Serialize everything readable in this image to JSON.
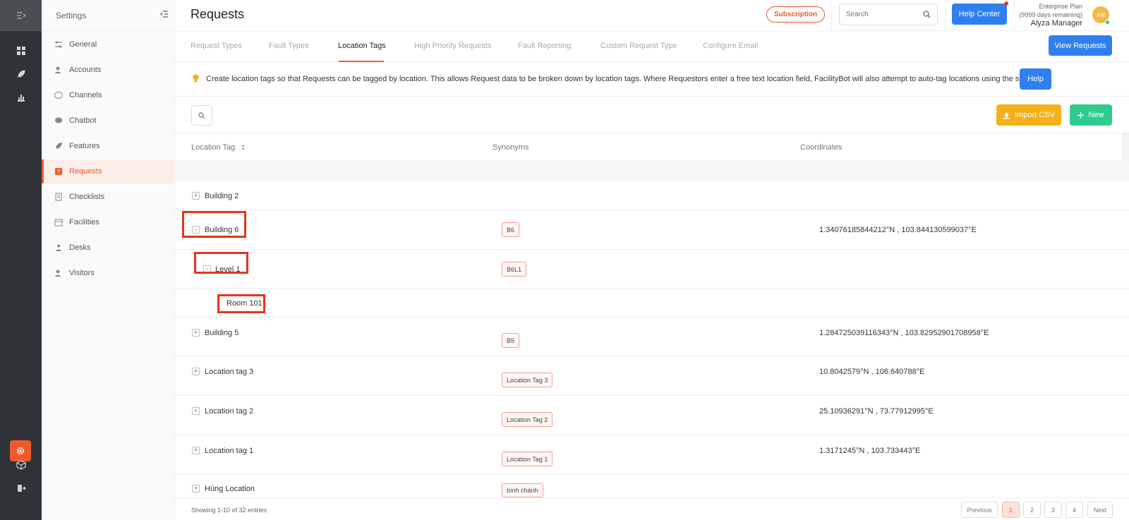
{
  "settings_title": "Settings",
  "sidebar": {
    "items": [
      {
        "label": "General",
        "icon": "sliders-icon"
      },
      {
        "label": "Accounts",
        "icon": "users-icon"
      },
      {
        "label": "Channels",
        "icon": "cube-icon"
      },
      {
        "label": "Chatbot",
        "icon": "chat-icon"
      },
      {
        "label": "Features",
        "icon": "rocket-icon"
      },
      {
        "label": "Requests",
        "icon": "request-icon"
      },
      {
        "label": "Checklists",
        "icon": "checklist-icon"
      },
      {
        "label": "Facilities",
        "icon": "calendar-icon"
      },
      {
        "label": "Desks",
        "icon": "desk-icon"
      },
      {
        "label": "Visitors",
        "icon": "visitor-icon"
      }
    ],
    "active": "Requests"
  },
  "header": {
    "title": "Requests",
    "subscription": "Subscription",
    "search_placeholder": "Search",
    "help_center": "Help Center",
    "plan": "Enterprise Plan",
    "plan_remaining": "(9999 days remaining)",
    "user_name": "Alyza Manager",
    "avatar_initials": "AM"
  },
  "tabs": [
    "Request Types",
    "Fault Types",
    "Location Tags",
    "High Priority Requests",
    "Fault Reporting",
    "Custom Request Type",
    "Configure Email"
  ],
  "active_tab": "Location Tags",
  "view_requests": "View Requests",
  "info": {
    "text": "Create location tags so that Requests can be tagged by location. This allows Request data to be broken down by location tags. Where Requestors enter a free text location field, FacilityBot will also attempt to auto-tag locations using the synonyms.",
    "help": "Help"
  },
  "toolbar": {
    "import_csv": "Import CSV",
    "new": "New"
  },
  "table": {
    "columns": [
      "Location Tag",
      "Synonyms",
      "Coordinates"
    ],
    "rows": [
      {
        "label": "Building 2",
        "expander": "+",
        "synonym": "",
        "coordinates": ""
      },
      {
        "label": "Building 6",
        "expander": "-",
        "synonym": "B6",
        "coordinates": "1.34076185844212°N , 103.844130599037°E"
      },
      {
        "label": "Level 1",
        "expander": "-",
        "synonym": "B6L1",
        "coordinates": ""
      },
      {
        "label": "Room 101",
        "expander": "",
        "synonym": "",
        "coordinates": ""
      },
      {
        "label": "Building 5",
        "expander": "+",
        "synonym": "B5",
        "coordinates": "1.284725039116343°N , 103.82952901708958°E"
      },
      {
        "label": "Location tag 3",
        "expander": "+",
        "synonym": "Location Tag 3",
        "coordinates": "10.8042579°N , 106.640788°E"
      },
      {
        "label": "Location tag 2",
        "expander": "+",
        "synonym": "Location Tag 2",
        "coordinates": "25.10936291°N , 73.77912995°E"
      },
      {
        "label": "Location tag 1",
        "expander": "+",
        "synonym": "Location Tag 1",
        "coordinates": "1.3171245°N , 103.733443°E"
      },
      {
        "label": "Hùng Location",
        "expander": "+",
        "synonym": "bình chánh",
        "coordinates": ""
      }
    ]
  },
  "footer": {
    "showing": "Showing 1-10 of 32 entries",
    "previous": "Previous",
    "pages": [
      "1",
      "2",
      "3",
      "4"
    ],
    "current_page": "1",
    "next": "Next"
  },
  "colors": {
    "accent": "#ee5a2b",
    "primary": "#2f80ed",
    "import": "#f5b01a",
    "new": "#2ecc8f",
    "rail": "#2f3237",
    "highlight": "#e5341d"
  }
}
